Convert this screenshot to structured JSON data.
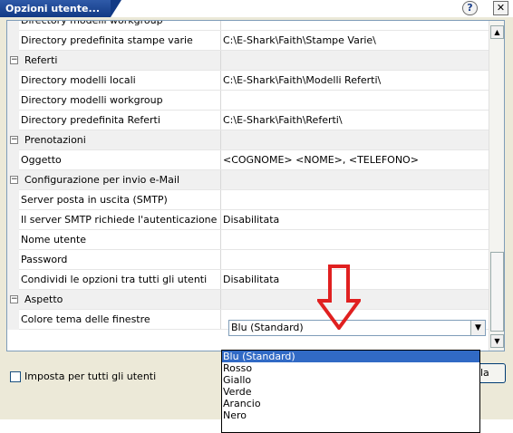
{
  "window": {
    "title": "Opzioni utente...",
    "help_label": "?",
    "close_label": "✕"
  },
  "grid": {
    "rows": [
      {
        "type": "prop",
        "name": "Directory modelli workgroup",
        "value": ""
      },
      {
        "type": "prop",
        "name": "Directory predefinita stampe varie",
        "value": "C:\\E-Shark\\Faith\\Stampe Varie\\"
      },
      {
        "type": "cat",
        "name": "Referti"
      },
      {
        "type": "prop",
        "name": "Directory modelli locali",
        "value": "C:\\E-Shark\\Faith\\Modelli Referti\\"
      },
      {
        "type": "prop",
        "name": "Directory modelli workgroup",
        "value": ""
      },
      {
        "type": "prop",
        "name": "Directory predefinita Referti",
        "value": "C:\\E-Shark\\Faith\\Referti\\"
      },
      {
        "type": "cat",
        "name": "Prenotazioni"
      },
      {
        "type": "prop",
        "name": "Oggetto",
        "value": "<COGNOME> <NOME>, <TELEFONO>"
      },
      {
        "type": "cat",
        "name": "Configurazione per invio e-Mail"
      },
      {
        "type": "prop",
        "name": "Server posta in uscita (SMTP)",
        "value": ""
      },
      {
        "type": "prop",
        "name": "Il server SMTP richiede l'autenticazione",
        "value": "Disabilitata"
      },
      {
        "type": "prop",
        "name": "Nome utente",
        "value": ""
      },
      {
        "type": "prop",
        "name": "Password",
        "value": ""
      },
      {
        "type": "prop",
        "name": "Condividi le opzioni tra tutti gli utenti",
        "value": "Disabilitata"
      },
      {
        "type": "cat",
        "name": "Aspetto"
      },
      {
        "type": "prop",
        "name": "Colore tema delle finestre",
        "value": ""
      }
    ],
    "expander_symbol": "⊟"
  },
  "combo": {
    "value": "Blu (Standard)",
    "options": [
      "Blu (Standard)",
      "Rosso",
      "Giallo",
      "Verde",
      "Arancio",
      "Nero"
    ],
    "selected_index": 0
  },
  "footer": {
    "apply_all_label": "Imposta per tutti gli utenti",
    "button_partial_label": "la"
  },
  "colors": {
    "title_bar": "#1c4a9c",
    "selection": "#316ac5",
    "arrow": "#e02020"
  }
}
